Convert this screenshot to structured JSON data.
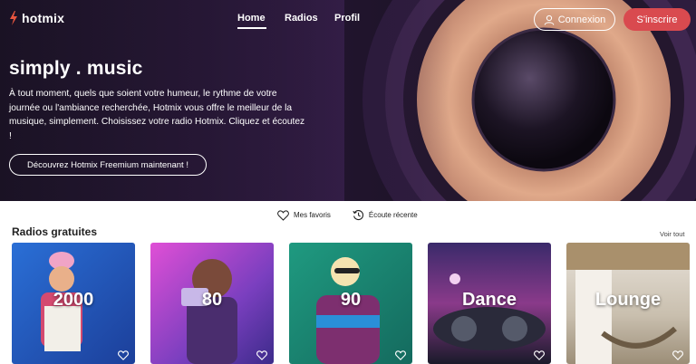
{
  "brand": {
    "name": "hotmix"
  },
  "nav": {
    "home": "Home",
    "radios": "Radios",
    "profil": "Profil"
  },
  "auth": {
    "login_label": "Connexion",
    "signup_label": "S'inscrire"
  },
  "hero": {
    "title": "simply . music",
    "description": "À tout moment, quels que soient votre humeur, le rythme de votre journée ou l'ambiance recherchée, Hotmix vous offre le meilleur de la musique, simplement. Choisissez votre radio Hotmix. Cliquez et écoutez !",
    "cta_label": "Découvrez Hotmix Freemium maintenant !"
  },
  "quick_links": {
    "favorites": "Mes favoris",
    "recent": "Écoute récente"
  },
  "section": {
    "title": "Radios gratuites",
    "see_all": "Voir tout"
  },
  "cards": [
    {
      "label": "2000"
    },
    {
      "label": "80"
    },
    {
      "label": "90"
    },
    {
      "label": "Dance"
    },
    {
      "label": "Lounge"
    }
  ],
  "colors": {
    "accent": "#d94a4f",
    "hero_bg": "#2a1838"
  }
}
